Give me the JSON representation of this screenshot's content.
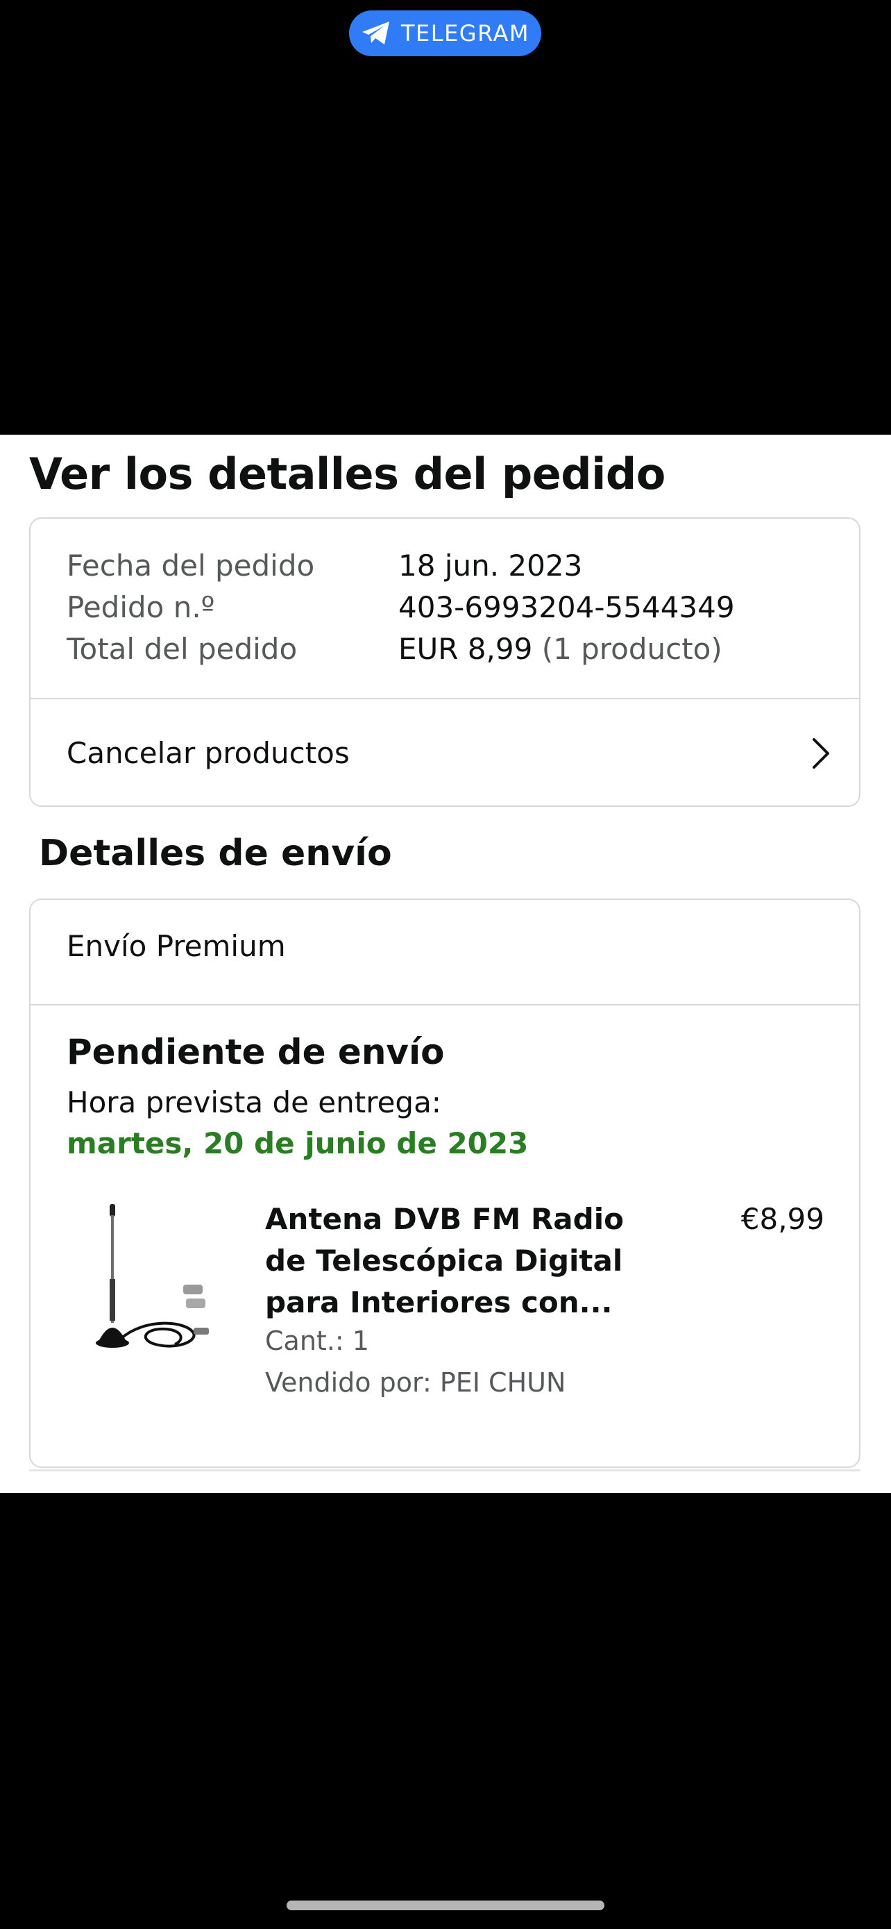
{
  "overlay": {
    "telegram_label": "TELEGRAM",
    "icon": "telegram-paper-plane-icon",
    "accent": "#2f7cf6"
  },
  "page": {
    "title": "Ver los detalles del pedido"
  },
  "order_summary": {
    "rows": [
      {
        "label": "Fecha del pedido",
        "value": "18 jun. 2023",
        "sub": ""
      },
      {
        "label": "Pedido n.º",
        "value": "403-6993204-5544349",
        "sub": ""
      },
      {
        "label": "Total del pedido",
        "value": "EUR 8,99",
        "sub": "(1 producto)"
      }
    ],
    "cancel_label": "Cancelar productos",
    "cancel_icon": "chevron-right-icon"
  },
  "shipping": {
    "section_title": "Detalles de envío",
    "method": "Envío Premium",
    "status": "Pendiente de envío",
    "eta_label": "Hora prevista de entrega:",
    "eta_date": "martes, 20 de junio de 2023",
    "eta_color": "#2b7d24"
  },
  "product": {
    "name": "Antena DVB FM Radio de Telescópica Digital para Interiores con...",
    "price": "€8,99",
    "quantity": "Cant.: 1",
    "seller": "Vendido por: PEI CHUN",
    "image_icon": "antenna-product-image"
  }
}
